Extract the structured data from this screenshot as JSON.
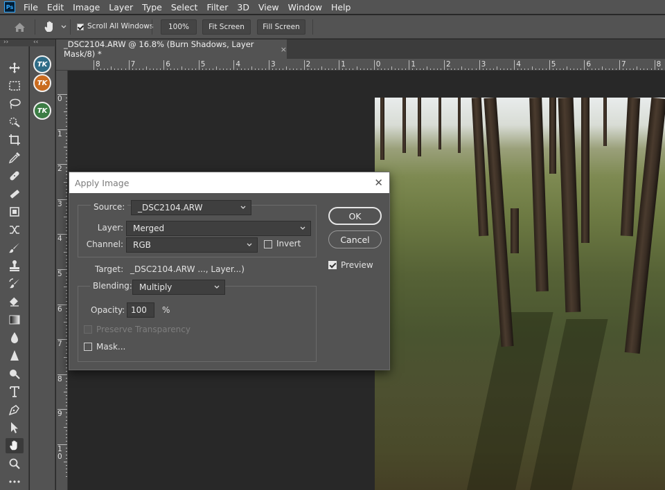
{
  "app": {
    "logo_text": "Ps"
  },
  "menu": [
    "File",
    "Edit",
    "Image",
    "Layer",
    "Type",
    "Select",
    "Filter",
    "3D",
    "View",
    "Window",
    "Help"
  ],
  "options_bar": {
    "scroll_all_windows_label": "Scroll All Windows",
    "scroll_all_windows_checked": true,
    "zoom_button": "100%",
    "fit_screen_button": "Fit Screen",
    "fill_screen_button": "Fill Screen"
  },
  "document": {
    "tab_title": "_DSC2104.ARW @ 16.8% (Burn Shadows, Layer Mask/8) *",
    "close_glyph": "×"
  },
  "rulers": {
    "horizontal_labels": [
      "8",
      "7",
      "6",
      "5",
      "4",
      "3",
      "2",
      "1",
      "0",
      "1",
      "2",
      "3",
      "4",
      "5",
      "6",
      "7",
      "8"
    ],
    "vertical_labels": [
      "0",
      "1",
      "2",
      "3",
      "4",
      "5",
      "6",
      "7",
      "8",
      "9",
      "1 0"
    ]
  },
  "tools": [
    "move-tool-icon",
    "marquee-tool-icon",
    "lasso-tool-icon",
    "quick-selection-tool-icon",
    "crop-tool-icon",
    "eyedropper-tool-icon",
    "healing-brush-tool-icon",
    "patch-tool-icon",
    "content-aware-move-tool-icon",
    "red-eye-tool-icon",
    "brush-tool-icon",
    "clone-stamp-tool-icon",
    "history-brush-tool-icon",
    "eraser-tool-icon",
    "gradient-tool-icon",
    "blur-tool-icon",
    "sharpen-tool-icon",
    "dodge-tool-icon",
    "type-tool-icon",
    "pen-tool-icon",
    "path-selection-tool-icon",
    "hand-tool-icon",
    "zoom-tool-icon",
    "more-tools-icon"
  ],
  "plugins": [
    {
      "label": "TK",
      "color": "#2f6c86"
    },
    {
      "label": "TK",
      "color": "#c96b1f"
    },
    {
      "label": "TK",
      "color": "#3c7d45"
    }
  ],
  "dialog": {
    "title": "Apply Image",
    "close_glyph": "✕",
    "source_label": "Source:",
    "source_value": "_DSC2104.ARW",
    "layer_label": "Layer:",
    "layer_value": "Merged",
    "channel_label": "Channel:",
    "channel_value": "RGB",
    "invert_label": "Invert",
    "invert_checked": false,
    "target_label": "Target:",
    "target_value": "_DSC2104.ARW ..., Layer...)",
    "blending_label": "Blending:",
    "blending_value": "Multiply",
    "opacity_label": "Opacity:",
    "opacity_value": "100",
    "opacity_unit": "%",
    "preserve_transparency_label": "Preserve Transparency",
    "preserve_transparency_enabled": false,
    "mask_label": "Mask...",
    "mask_checked": false,
    "ok_button": "OK",
    "cancel_button": "Cancel",
    "preview_label": "Preview",
    "preview_checked": true
  }
}
